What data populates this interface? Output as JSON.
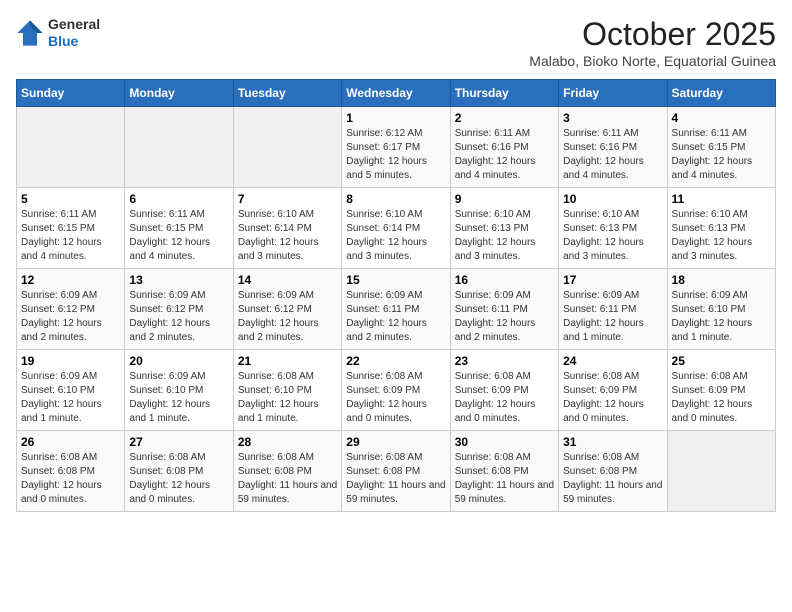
{
  "header": {
    "logo": {
      "general": "General",
      "blue": "Blue"
    },
    "month": "October 2025",
    "location": "Malabo, Bioko Norte, Equatorial Guinea"
  },
  "weekdays": [
    "Sunday",
    "Monday",
    "Tuesday",
    "Wednesday",
    "Thursday",
    "Friday",
    "Saturday"
  ],
  "weeks": [
    [
      {
        "day": "",
        "info": ""
      },
      {
        "day": "",
        "info": ""
      },
      {
        "day": "",
        "info": ""
      },
      {
        "day": "1",
        "sunrise": "6:12 AM",
        "sunset": "6:17 PM",
        "daylight": "12 hours and 5 minutes."
      },
      {
        "day": "2",
        "sunrise": "6:11 AM",
        "sunset": "6:16 PM",
        "daylight": "12 hours and 4 minutes."
      },
      {
        "day": "3",
        "sunrise": "6:11 AM",
        "sunset": "6:16 PM",
        "daylight": "12 hours and 4 minutes."
      },
      {
        "day": "4",
        "sunrise": "6:11 AM",
        "sunset": "6:15 PM",
        "daylight": "12 hours and 4 minutes."
      }
    ],
    [
      {
        "day": "5",
        "sunrise": "6:11 AM",
        "sunset": "6:15 PM",
        "daylight": "12 hours and 4 minutes."
      },
      {
        "day": "6",
        "sunrise": "6:11 AM",
        "sunset": "6:15 PM",
        "daylight": "12 hours and 4 minutes."
      },
      {
        "day": "7",
        "sunrise": "6:10 AM",
        "sunset": "6:14 PM",
        "daylight": "12 hours and 3 minutes."
      },
      {
        "day": "8",
        "sunrise": "6:10 AM",
        "sunset": "6:14 PM",
        "daylight": "12 hours and 3 minutes."
      },
      {
        "day": "9",
        "sunrise": "6:10 AM",
        "sunset": "6:13 PM",
        "daylight": "12 hours and 3 minutes."
      },
      {
        "day": "10",
        "sunrise": "6:10 AM",
        "sunset": "6:13 PM",
        "daylight": "12 hours and 3 minutes."
      },
      {
        "day": "11",
        "sunrise": "6:10 AM",
        "sunset": "6:13 PM",
        "daylight": "12 hours and 3 minutes."
      }
    ],
    [
      {
        "day": "12",
        "sunrise": "6:09 AM",
        "sunset": "6:12 PM",
        "daylight": "12 hours and 2 minutes."
      },
      {
        "day": "13",
        "sunrise": "6:09 AM",
        "sunset": "6:12 PM",
        "daylight": "12 hours and 2 minutes."
      },
      {
        "day": "14",
        "sunrise": "6:09 AM",
        "sunset": "6:12 PM",
        "daylight": "12 hours and 2 minutes."
      },
      {
        "day": "15",
        "sunrise": "6:09 AM",
        "sunset": "6:11 PM",
        "daylight": "12 hours and 2 minutes."
      },
      {
        "day": "16",
        "sunrise": "6:09 AM",
        "sunset": "6:11 PM",
        "daylight": "12 hours and 2 minutes."
      },
      {
        "day": "17",
        "sunrise": "6:09 AM",
        "sunset": "6:11 PM",
        "daylight": "12 hours and 1 minute."
      },
      {
        "day": "18",
        "sunrise": "6:09 AM",
        "sunset": "6:10 PM",
        "daylight": "12 hours and 1 minute."
      }
    ],
    [
      {
        "day": "19",
        "sunrise": "6:09 AM",
        "sunset": "6:10 PM",
        "daylight": "12 hours and 1 minute."
      },
      {
        "day": "20",
        "sunrise": "6:09 AM",
        "sunset": "6:10 PM",
        "daylight": "12 hours and 1 minute."
      },
      {
        "day": "21",
        "sunrise": "6:08 AM",
        "sunset": "6:10 PM",
        "daylight": "12 hours and 1 minute."
      },
      {
        "day": "22",
        "sunrise": "6:08 AM",
        "sunset": "6:09 PM",
        "daylight": "12 hours and 0 minutes."
      },
      {
        "day": "23",
        "sunrise": "6:08 AM",
        "sunset": "6:09 PM",
        "daylight": "12 hours and 0 minutes."
      },
      {
        "day": "24",
        "sunrise": "6:08 AM",
        "sunset": "6:09 PM",
        "daylight": "12 hours and 0 minutes."
      },
      {
        "day": "25",
        "sunrise": "6:08 AM",
        "sunset": "6:09 PM",
        "daylight": "12 hours and 0 minutes."
      }
    ],
    [
      {
        "day": "26",
        "sunrise": "6:08 AM",
        "sunset": "6:08 PM",
        "daylight": "12 hours and 0 minutes."
      },
      {
        "day": "27",
        "sunrise": "6:08 AM",
        "sunset": "6:08 PM",
        "daylight": "12 hours and 0 minutes."
      },
      {
        "day": "28",
        "sunrise": "6:08 AM",
        "sunset": "6:08 PM",
        "daylight": "11 hours and 59 minutes."
      },
      {
        "day": "29",
        "sunrise": "6:08 AM",
        "sunset": "6:08 PM",
        "daylight": "11 hours and 59 minutes."
      },
      {
        "day": "30",
        "sunrise": "6:08 AM",
        "sunset": "6:08 PM",
        "daylight": "11 hours and 59 minutes."
      },
      {
        "day": "31",
        "sunrise": "6:08 AM",
        "sunset": "6:08 PM",
        "daylight": "11 hours and 59 minutes."
      },
      {
        "day": "",
        "info": ""
      }
    ]
  ]
}
